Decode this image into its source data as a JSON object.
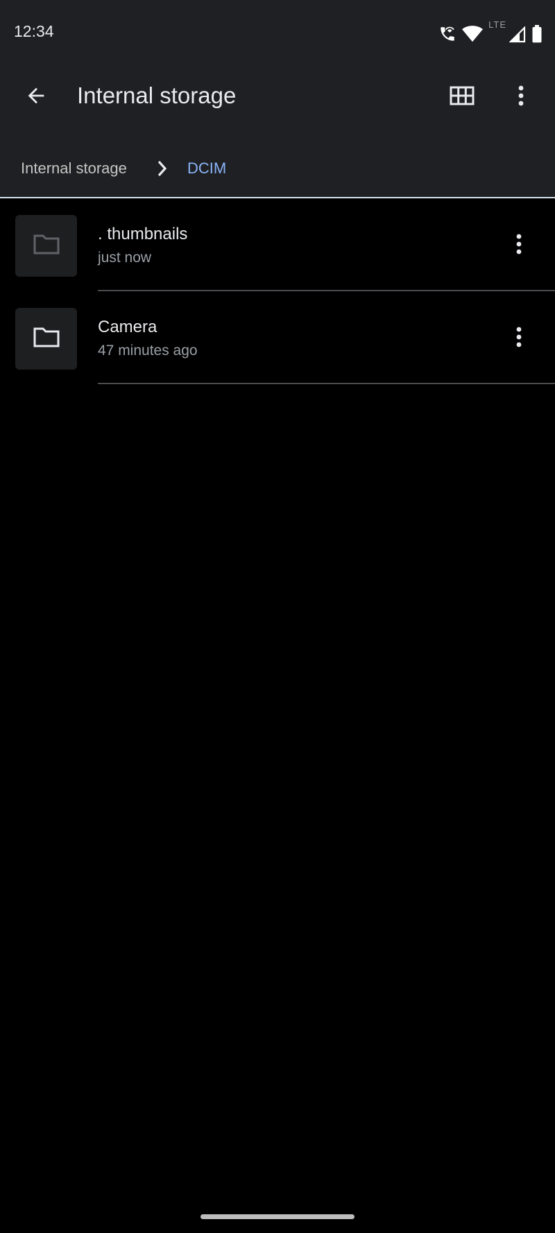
{
  "status_bar": {
    "time": "12:34",
    "network_label": "LTE",
    "icons": [
      "wifi-call-icon",
      "wifi-icon",
      "signal-icon",
      "battery-icon"
    ]
  },
  "app_bar": {
    "title": "Internal storage",
    "back_icon": "arrow-back-icon",
    "view_toggle_icon": "grid-view-icon",
    "overflow_icon": "more-vert-icon"
  },
  "breadcrumb": {
    "root": "Internal storage",
    "current": "DCIM",
    "separator_icon": "chevron-right-icon"
  },
  "files": [
    {
      "name": ". thumbnails",
      "meta": "just now",
      "type": "folder"
    },
    {
      "name": "Camera",
      "meta": "47 minutes ago",
      "type": "folder"
    }
  ],
  "colors": {
    "top_background": "#1f2023",
    "list_background": "#000000",
    "accent": "#8ab4f8",
    "primary_text": "#e8eaed",
    "secondary_text": "#9aa0a6",
    "divider": "#4a4c50",
    "folder_tile": "#1e1f21"
  }
}
